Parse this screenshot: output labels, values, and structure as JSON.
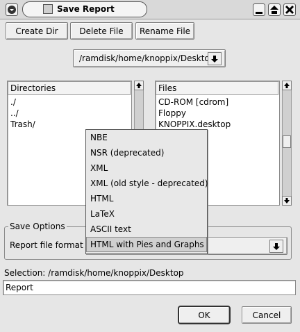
{
  "window": {
    "title": "Save Report"
  },
  "toolbar": {
    "create_dir": "Create Dir",
    "delete_file": "Delete File",
    "rename_file": "Rename File"
  },
  "path_combo": {
    "value": "/ramdisk/home/knoppix/Desktop"
  },
  "directories": {
    "header": "Directories",
    "items": [
      "./",
      "../",
      "Trash/"
    ]
  },
  "files": {
    "header": "Files",
    "items": [
      "CD-ROM [cdrom]",
      "Floppy",
      "KNOPPIX.desktop"
    ]
  },
  "save_options": {
    "legend": "Save Options",
    "format_label": "Report file format :"
  },
  "format_menu": {
    "options": [
      "NBE",
      "NSR (deprecated)",
      "XML",
      "XML (old style - deprecated)",
      "HTML",
      "LaTeX",
      "ASCII text",
      "HTML with Pies and Graphs"
    ],
    "selected": "HTML with Pies and Graphs"
  },
  "selection": {
    "label": "Selection: /ramdisk/home/knoppix/Desktop",
    "value": "Report"
  },
  "buttons": {
    "ok": "OK",
    "cancel": "Cancel"
  }
}
